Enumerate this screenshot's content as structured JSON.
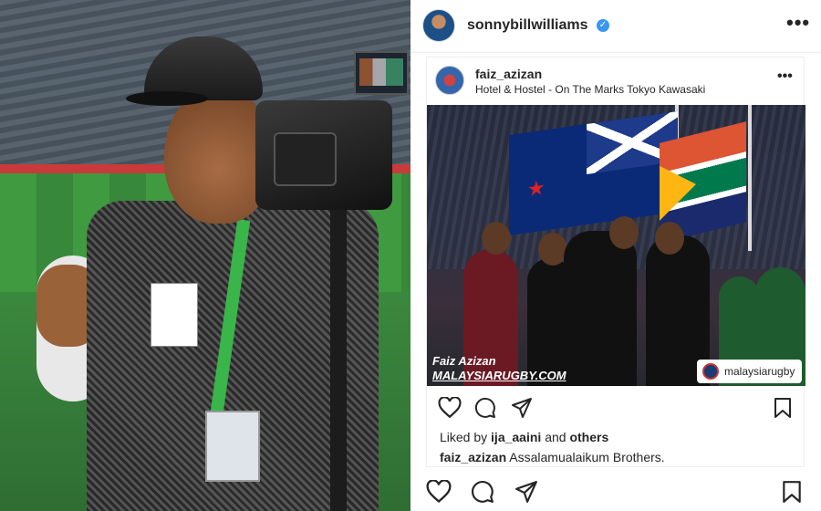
{
  "profile": {
    "username": "sonnybillwilliams",
    "verified_icon": "✓",
    "more_icon": "•••"
  },
  "post": {
    "username": "faiz_azizan",
    "location": "Hotel & Hostel - On The Marks Tokyo Kawasaki",
    "more_icon": "•••",
    "watermark_name": "Faiz Azizan",
    "watermark_site": "MALAYSIARUGBY.COM",
    "tag_label": "malaysiarugby",
    "liked_prefix": "Liked by ",
    "liked_user": "ija_aaini",
    "liked_mid": " and ",
    "liked_others": "others",
    "caption_user": "faiz_azizan",
    "caption_text": " Assalamualaikum Brothers."
  },
  "icons": {
    "heart": "heart-icon",
    "comment": "comment-icon",
    "share": "share-icon",
    "bookmark": "bookmark-icon"
  },
  "colors": {
    "verified": "#3897f0",
    "text": "#262626"
  }
}
